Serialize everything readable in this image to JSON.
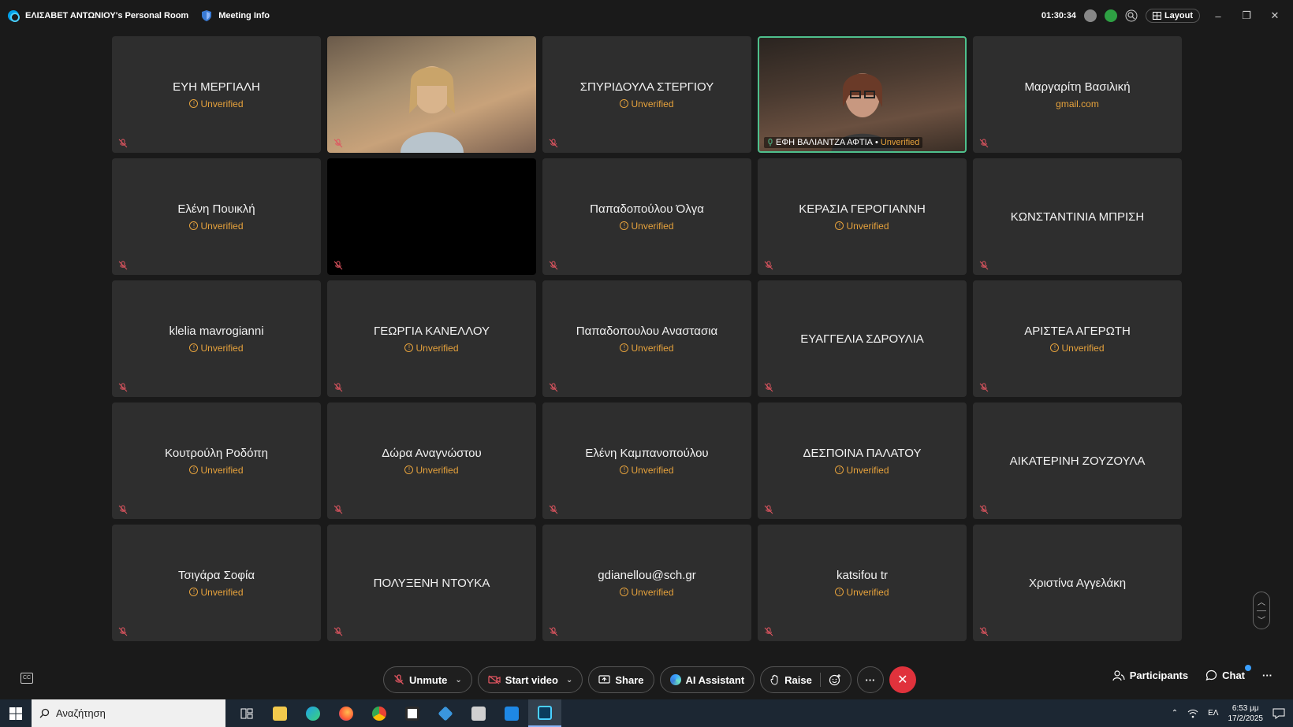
{
  "titlebar": {
    "room_title": "ΕΛΙΣΑΒΕΤ ΑΝΤΩΝΙΟΥ's Personal Room",
    "meeting_info": "Meeting Info",
    "timer": "01:30:34",
    "layout_label": "Layout"
  },
  "tiles": [
    {
      "name": "ΕΥΗ ΜΕΡΓΙΑΛΗ",
      "status": "Unverified"
    },
    {
      "name": "",
      "status": ""
    },
    {
      "name": "ΣΠΥΡΙΔΟΥΛΑ ΣΤΕΡΓΙΟΥ",
      "status": "Unverified"
    },
    {
      "name": "ΕΦΗ ΒΑΛΙΑΝΤΖΑ ΑΦΤΙΑ",
      "status": "Unverified"
    },
    {
      "name": "Μαργαρίτη Βασιλική",
      "status": "gmail.com"
    },
    {
      "name": "Ελένη Πουικλή",
      "status": "Unverified"
    },
    {
      "name": "",
      "status": ""
    },
    {
      "name": "Παπαδοπούλου Όλγα",
      "status": "Unverified"
    },
    {
      "name": "ΚΕΡΑΣΙΑ ΓΕΡΟΓΙΑΝΝΗ",
      "status": "Unverified"
    },
    {
      "name": "ΚΩΝΣΤΑΝΤΙΝΙΑ ΜΠΡΙΣΗ",
      "status": ""
    },
    {
      "name": "klelia mavrogianni",
      "status": "Unverified"
    },
    {
      "name": "ΓΕΩΡΓΙΑ ΚΑΝΕΛΛΟΥ",
      "status": "Unverified"
    },
    {
      "name": "Παπαδοπουλου Αναστασια",
      "status": "Unverified"
    },
    {
      "name": "ΕΥΑΓΓΕΛΙΑ ΣΔΡΟΥΛΙΑ",
      "status": ""
    },
    {
      "name": "ΑΡΙΣΤΕΑ ΑΓΕΡΩΤΗ",
      "status": "Unverified"
    },
    {
      "name": "Κουτρούλη Ροδόπη",
      "status": "Unverified"
    },
    {
      "name": "Δώρα Αναγνώστου",
      "status": "Unverified"
    },
    {
      "name": "Ελένη Καμπανοπούλου",
      "status": "Unverified"
    },
    {
      "name": "ΔΕΣΠΟΙΝΑ ΠΑΛΑΤΟΥ",
      "status": "Unverified"
    },
    {
      "name": "ΑΙΚΑΤΕΡΙΝΗ ΖΟΥΖΟΥΛΑ",
      "status": ""
    },
    {
      "name": "Τσιγάρα Σοφία",
      "status": "Unverified"
    },
    {
      "name": "ΠΟΛΥΞΕΝΗ ΝΤΟΥΚΑ",
      "status": ""
    },
    {
      "name": "gdianellou@sch.gr",
      "status": "Unverified"
    },
    {
      "name": "katsifou tr",
      "status": "Unverified"
    },
    {
      "name": "Χριστίνα Αγγελάκη",
      "status": ""
    }
  ],
  "toolbar": {
    "unmute": "Unmute",
    "start_video": "Start video",
    "share": "Share",
    "ai_assistant": "AI Assistant",
    "raise": "Raise",
    "more": "···",
    "participants": "Participants",
    "chat": "Chat",
    "overflow": "···"
  },
  "taskbar": {
    "search_placeholder": "Αναζήτηση",
    "lang": "ΕΛ",
    "time": "6:53 μμ",
    "date": "17/2/2025"
  },
  "colors": {
    "unverified": "#e6a23c",
    "active_border": "#4fc08d",
    "end_call": "#e0323c",
    "tile_bg": "#2e2e2e"
  }
}
